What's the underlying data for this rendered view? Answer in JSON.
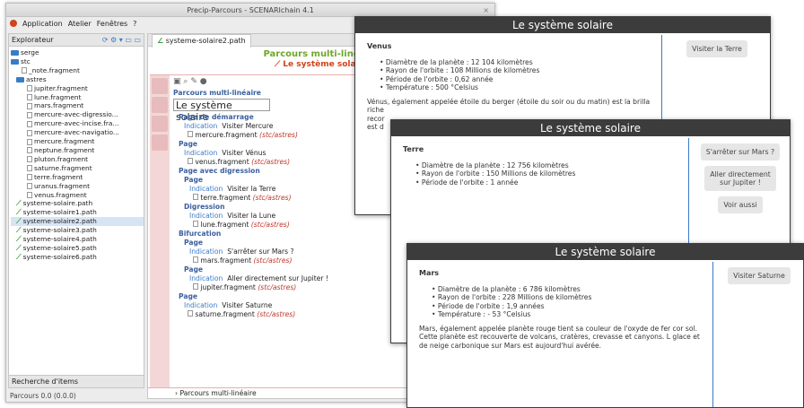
{
  "app": {
    "title": "Precip-Parcours - SCENARIchain 4.1",
    "close": "×",
    "menus": [
      "Application",
      "Atelier",
      "Fenêtres",
      "?"
    ]
  },
  "explorer": {
    "title": "Explorateur",
    "tree": [
      {
        "label": "serge",
        "kind": "folder",
        "indent": 0
      },
      {
        "label": "stc",
        "kind": "folder",
        "indent": 0
      },
      {
        "label": "_note.fragment",
        "kind": "file",
        "indent": 2
      },
      {
        "label": "astres",
        "kind": "folder",
        "indent": 1
      },
      {
        "label": "jupiter.fragment",
        "kind": "file",
        "indent": 3
      },
      {
        "label": "lune.fragment",
        "kind": "file",
        "indent": 3
      },
      {
        "label": "mars.fragment",
        "kind": "file",
        "indent": 3
      },
      {
        "label": "mercure-avec-digressio...",
        "kind": "file",
        "indent": 3
      },
      {
        "label": "mercure-avec-incise.fra...",
        "kind": "file",
        "indent": 3
      },
      {
        "label": "mercure-avec-navigatio...",
        "kind": "file",
        "indent": 3
      },
      {
        "label": "mercure.fragment",
        "kind": "file",
        "indent": 3
      },
      {
        "label": "neptune.fragment",
        "kind": "file",
        "indent": 3
      },
      {
        "label": "pluton.fragment",
        "kind": "file",
        "indent": 3
      },
      {
        "label": "saturne.fragment",
        "kind": "file",
        "indent": 3
      },
      {
        "label": "terre.fragment",
        "kind": "file",
        "indent": 3
      },
      {
        "label": "uranus.fragment",
        "kind": "file",
        "indent": 3
      },
      {
        "label": "venus.fragment",
        "kind": "file",
        "indent": 3
      },
      {
        "label": "systeme-solaire.path",
        "kind": "path",
        "indent": 1
      },
      {
        "label": "systeme-solaire1.path",
        "kind": "path",
        "indent": 1
      },
      {
        "label": "systeme-solaire2.path",
        "kind": "path",
        "indent": 1,
        "selected": true
      },
      {
        "label": "systeme-solaire3.path",
        "kind": "path",
        "indent": 1
      },
      {
        "label": "systeme-solaire4.path",
        "kind": "path",
        "indent": 1
      },
      {
        "label": "systeme-solaire5.path",
        "kind": "path",
        "indent": 1
      },
      {
        "label": "systeme-solaire6.path",
        "kind": "path",
        "indent": 1
      }
    ],
    "search": "Recherche d'items"
  },
  "status": "Parcours 0.0 (0.0.0)",
  "editor": {
    "tab": "systeme-solaire2.path",
    "heading": "Parcours multi-linéaire",
    "subheading": "Le système solaire",
    "side_label": "Edition",
    "kind": "Parcours multi-linéaire",
    "title": "Le système solaire",
    "sections": [
      {
        "head": "Page de démarrage",
        "indication": "Visiter Mercure",
        "fragment": "mercure.fragment",
        "path": "(stc/astres)"
      },
      {
        "head": "Page",
        "indication": "Visiter Vénus",
        "fragment": "venus.fragment",
        "path": "(stc/astres)"
      }
    ],
    "digression": {
      "head": "Page avec digression",
      "page": "Page",
      "page_indication": "Visiter la Terre",
      "page_fragment": "terre.fragment",
      "dig": "Digression",
      "dig_indication": "Visiter la Lune",
      "dig_fragment": "lune.fragment",
      "path": "(stc/astres)"
    },
    "bifurcation": {
      "head": "Bifurcation",
      "p1": "Page",
      "p1_indication": "S'arrêter sur Mars ?",
      "p1_fragment": "mars.fragment",
      "p2": "Page",
      "p2_indication": "Aller directement sur Jupiter !",
      "p2_fragment": "jupiter.fragment",
      "path": "(stc/astres)"
    },
    "last": {
      "head": "Page",
      "indication": "Visiter Saturne",
      "fragment": "saturne.fragment",
      "path": "(stc/astres)"
    },
    "indication_label": "Indication",
    "footer": "Parcours multi-linéaire"
  },
  "windows": {
    "title": "Le système solaire",
    "venus": {
      "name": "Venus",
      "facts": [
        "Diamètre de la planète : 12 104 kilomètres",
        "Rayon de l'orbite : 108 Millions de kilomètres",
        "Période de l'orbite : 0,62 année",
        "Température : 500 °Celsius"
      ],
      "text": "Vénus, également appelée étoile du berger (étoile du soir ou du matin) est la brilla",
      "text2": "riche",
      "text3": "recor",
      "text4": "est d",
      "button": "Visiter la Terre"
    },
    "terre": {
      "name": "Terre",
      "facts": [
        "Diamètre de la planète : 12 756 kilomètres",
        "Rayon de l'orbite : 150 Millions de kilomètres",
        "Période de l'orbite : 1 année"
      ],
      "buttons": [
        "S'arrêter sur Mars ?",
        "Aller directement sur Jupiter !",
        "Voir aussi"
      ]
    },
    "mars": {
      "name": "Mars",
      "facts": [
        "Diamètre de la planète : 6 786 kilomètres",
        "Rayon de l'orbite : 228 Millions de kilomètres",
        "Période de l'orbite : 1,9 années",
        "Température : - 53 °Celsius"
      ],
      "text": "Mars, également appelée planète rouge tient sa couleur de l'oxyde de fer cor sol. Cette planète est recouverte de volcans, cratères, crevasse et canyons. L glace et de neige carbonique sur Mars est aujourd'hui avérée.",
      "button": "Visiter Saturne"
    }
  }
}
